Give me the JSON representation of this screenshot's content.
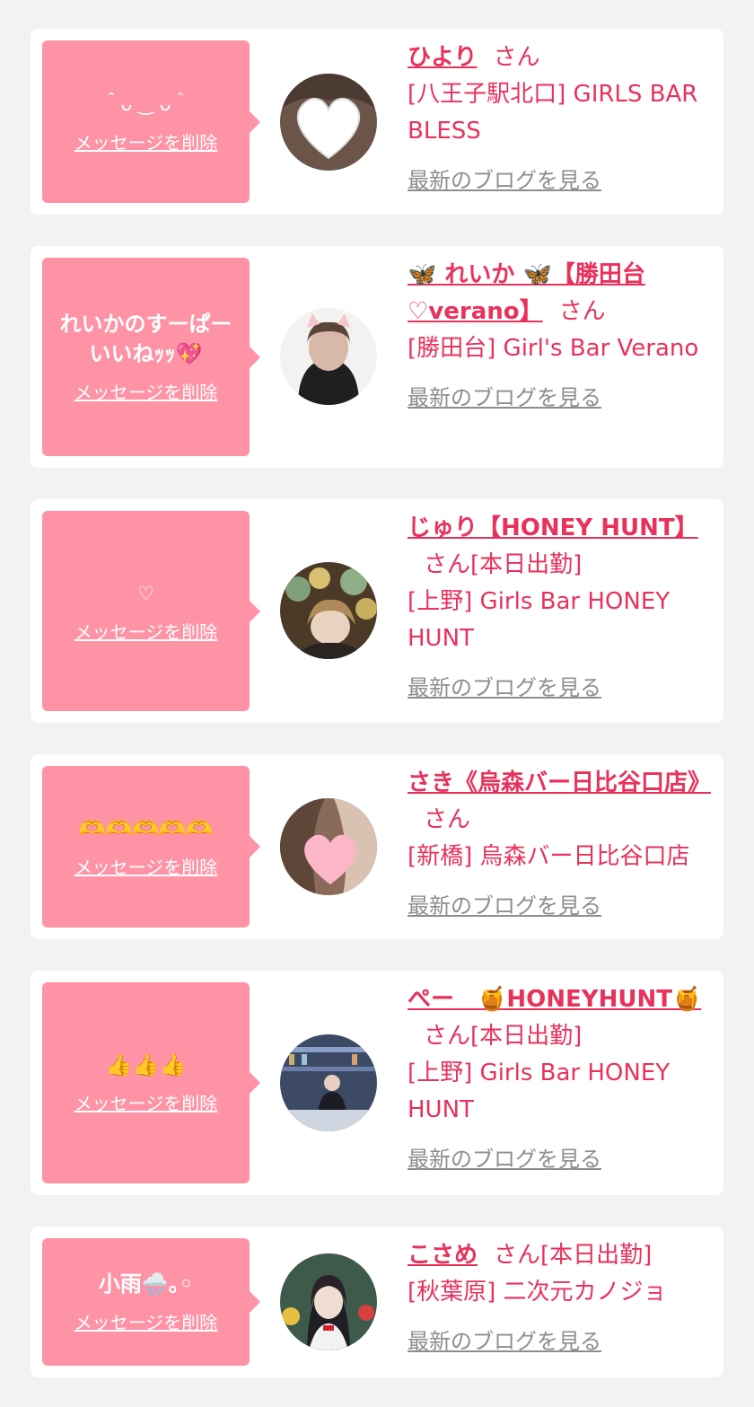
{
  "delete_label": "メッセージを削除",
  "blog_label": "最新のブログを見る",
  "san_label": "さん",
  "colors": {
    "accent": "#e8325c",
    "bubble": "#fe93a6",
    "background": "#f2f2f2",
    "muted": "#8e8e8e"
  },
  "cards": [
    {
      "message": "＾ᴗ ‿ ᴗ＾",
      "name": "ひより",
      "status": "",
      "shop": "[八王子駅北口] GIRLS BAR BLESS",
      "avatar_icon": "white-heart-avatar"
    },
    {
      "message": "れいかのすーぱーいいねｯｯ💖",
      "name": "🦋 れいか 🦋【勝田台♡verano】",
      "status": "",
      "shop": "[勝田台] Girl's Bar Verano",
      "avatar_icon": "cat-ears-avatar"
    },
    {
      "message": "♡",
      "name": "じゅり【HONEY HUNT】",
      "status": "[本日出勤]",
      "shop": "[上野] Girls Bar HONEY HUNT",
      "avatar_icon": "balloons-avatar"
    },
    {
      "message": "🫶🫶🫶🫶🫶",
      "name": "さき《烏森バー日比谷口店》",
      "status": "",
      "shop": "[新橋] 烏森バー日比谷口店",
      "avatar_icon": "pink-heart-avatar"
    },
    {
      "message": "👍👍👍",
      "name": "ぺー　🍯HONEYHUNT🍯",
      "status": "[本日出勤]",
      "shop": "[上野] Girls Bar HONEY HUNT",
      "avatar_icon": "bar-counter-avatar"
    },
    {
      "message": "小雨🌧️｡◦",
      "name": "こさめ",
      "status": "[本日出勤]",
      "shop": "[秋葉原] 二次元カノジョ",
      "avatar_icon": "maid-avatar"
    }
  ]
}
